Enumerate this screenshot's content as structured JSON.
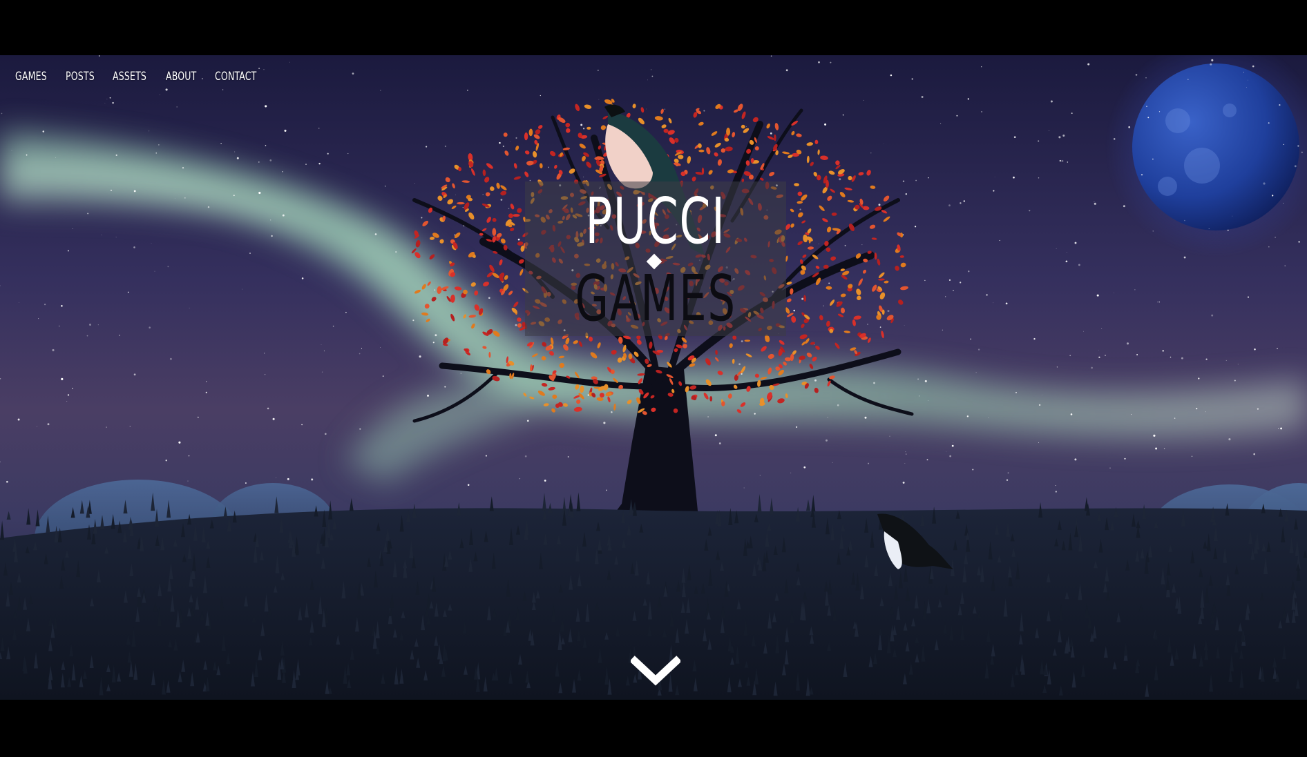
{
  "nav": {
    "items": [
      {
        "label": "GAMES"
      },
      {
        "label": "POSTS"
      },
      {
        "label": "ASSETS"
      },
      {
        "label": "ABOUT"
      },
      {
        "label": "CONTACT"
      }
    ]
  },
  "logo": {
    "line1": "PUCCI",
    "line2": "GAMES"
  },
  "icons": {
    "scroll_down": "chevron-down-icon",
    "separator": "diamond-icon"
  },
  "colors": {
    "sky_top": "#1c1a3a",
    "sky_mid": "#3a2f5c",
    "aurora": "#9ad6b2",
    "moon": "#1e3a8a",
    "leaves_red": "#d9302a",
    "leaves_orange": "#e07a1e",
    "grass": "#141a26",
    "letterbox": "#000000"
  }
}
